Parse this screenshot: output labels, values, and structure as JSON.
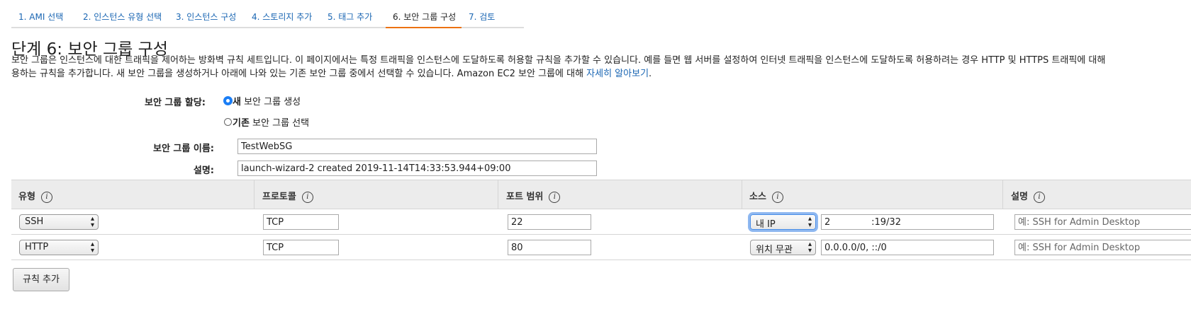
{
  "tabs": [
    {
      "label": "1. AMI 선택",
      "active": false
    },
    {
      "label": "2. 인스턴스 유형 선택",
      "active": false
    },
    {
      "label": "3. 인스턴스 구성",
      "active": false
    },
    {
      "label": "4. 스토리지 추가",
      "active": false
    },
    {
      "label": "5. 태그 추가",
      "active": false
    },
    {
      "label": "6. 보안 그룹 구성",
      "active": true
    },
    {
      "label": "7. 검토",
      "active": false
    }
  ],
  "page": {
    "title": "단계 6: 보안 그룹 구성",
    "description_line1": "보안 그룹은 인스턴스에 대한 트래픽을 제어하는 방화벽 규칙 세트입니다. 이 페이지에서는 특정 트래픽을 인스턴스에 도달하도록 허용할 규칙을 추가할 수 있습니다. 예를 들면 웹 서버를 설정하여 인터넷 트래픽을 인스턴스에 도달하도록 허용하려는 경우 HTTP 및 HTTPS 트래픽에 대해",
    "description_line2": "용하는 규칙을 추가합니다. 새 보안 그룹을 생성하거나 아래에 나와 있는 기존 보안 그룹 중에서 선택할 수 있습니다. Amazon EC2 보안 그룹에 대해 ",
    "learn_more_link": "자세히 알아보기",
    "learn_more_suffix": "."
  },
  "form": {
    "assign_label": "보안 그룹 할당:",
    "option_new_bold": "새",
    "option_new_rest": " 보안 그룹 생성",
    "option_existing_bold": "기존",
    "option_existing_rest": " 보안 그룹 선택",
    "selected_option": "new",
    "name_label": "보안 그룹 이름:",
    "name_value": "TestWebSG",
    "desc_label": "설명:",
    "desc_value": "launch-wizard-2 created 2019-11-14T14:33:53.944+09:00"
  },
  "table": {
    "headers": [
      "유형",
      "프로토콜",
      "포트 범위",
      "소스",
      "설명"
    ],
    "info_glyph": "i",
    "rows": [
      {
        "type": "SSH",
        "protocol": "TCP",
        "port": "22",
        "source_type": "내 IP",
        "source_value": "2              :19/32",
        "description_placeholder": "예: SSH for Admin Desktop"
      },
      {
        "type": "HTTP",
        "protocol": "TCP",
        "port": "80",
        "source_type": "위치 무관",
        "source_value": "0.0.0.0/0, ::/0",
        "description_placeholder": "예: SSH for Admin Desktop"
      }
    ]
  },
  "buttons": {
    "add_rule": "규칙 추가"
  },
  "colors": {
    "link": "#1a66b3",
    "active_tab_underline": "#ec7211",
    "radio_selected": "#1b7ef5"
  },
  "icons": {
    "info": "info-circle-icon",
    "select_arrow": "up-down-chevron-icon"
  }
}
